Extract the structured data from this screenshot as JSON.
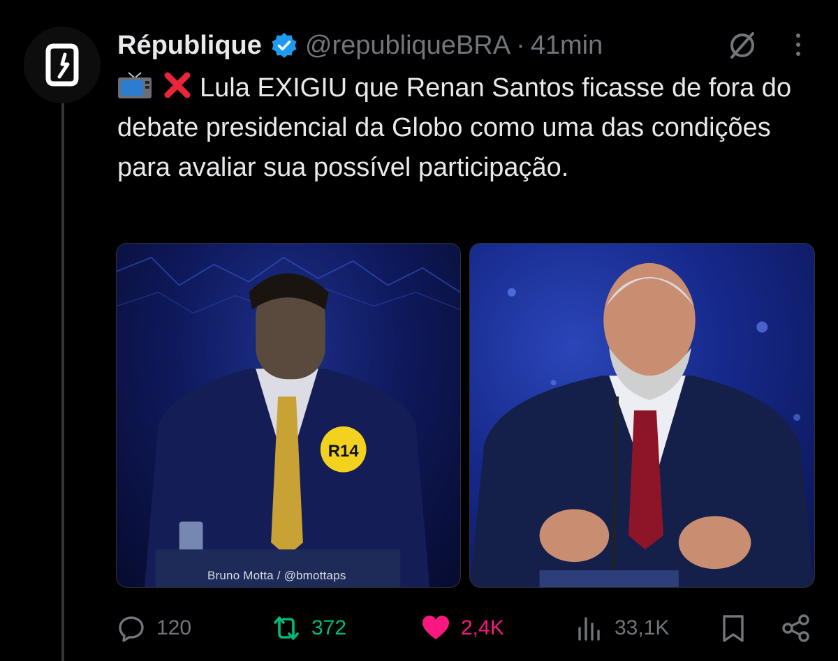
{
  "post": {
    "author": {
      "display_name": "République",
      "handle": "@republiqueBRA",
      "verified": true,
      "avatar_icon": "republique-logo-icon"
    },
    "separator": "·",
    "time_ago": "41min",
    "text": {
      "emoji_1": "tv-emoji",
      "emoji_2": "cross-mark-emoji",
      "body": "Lula EXIGIU que Renan Santos ficasse de fora do debate presidencial da Globo como uma das condições para avaliar sua possível participação."
    },
    "media": [
      {
        "name": "photo-renan-santos",
        "badge_text": "R14",
        "credit": "Bruno Motta / @bmottaps"
      },
      {
        "name": "photo-lula"
      }
    ],
    "actions": {
      "replies": "120",
      "reposts": "372",
      "likes": "2,4K",
      "views": "33,1K"
    }
  },
  "colors": {
    "background": "#000000",
    "text_primary": "#e7e9ea",
    "text_secondary": "#71767b",
    "verified_blue": "#1d9bf0",
    "repost_green": "#00ba7c",
    "like_pink": "#f91880",
    "thread_line": "#333639"
  }
}
